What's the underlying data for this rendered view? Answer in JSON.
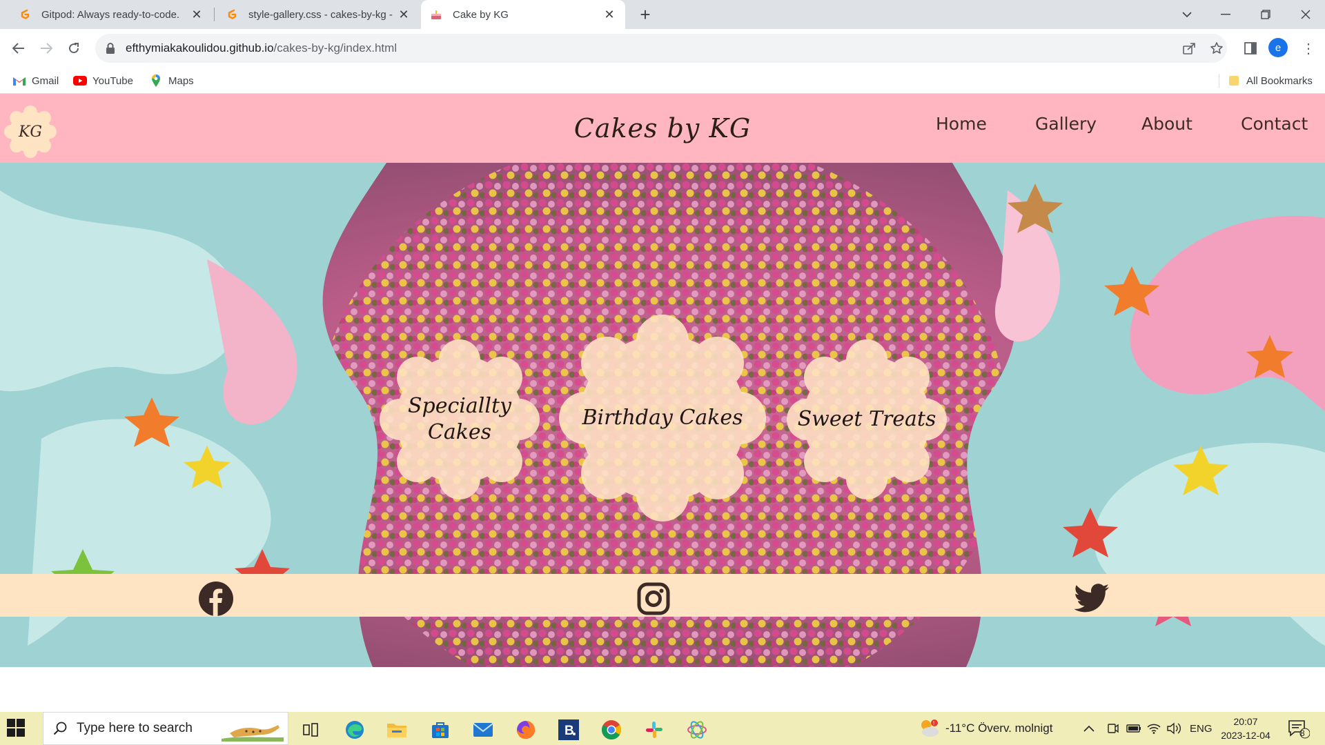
{
  "browser": {
    "tabs": [
      {
        "title": "Gitpod: Always ready-to-code.",
        "active": false,
        "icon": "gitpod-icon"
      },
      {
        "title": "style-gallery.css - cakes-by-kg -",
        "active": false,
        "icon": "gitpod-icon"
      },
      {
        "title": "Cake by KG",
        "active": true,
        "icon": "cake-icon"
      }
    ],
    "new_tab": "+",
    "url_domain": "efthymiakakoulidou.github.io",
    "url_path": "/cakes-by-kg/index.html",
    "profile_initial": "e",
    "bookmarks": [
      {
        "label": "Gmail",
        "icon": "gmail-icon"
      },
      {
        "label": "YouTube",
        "icon": "youtube-icon"
      },
      {
        "label": "Maps",
        "icon": "maps-icon"
      }
    ],
    "all_bookmarks": "All Bookmarks"
  },
  "site": {
    "logo_text": "KG",
    "title": "Cakes by KG",
    "nav": [
      "Home",
      "Gallery",
      "About",
      "Contact"
    ],
    "categories": [
      "Speciallty Cakes",
      "Birthday Cakes",
      "Sweet Treats"
    ],
    "social": [
      "facebook-icon",
      "instagram-icon",
      "twitter-icon"
    ],
    "colors": {
      "header": "#ffb6c1",
      "footer": "#ffe4c4",
      "blob": "#ffe4c4",
      "text": "#3b2a25"
    }
  },
  "taskbar": {
    "search_placeholder": "Type here to search",
    "weather": "-11°C  Överv. molnigt",
    "language": "ENG",
    "time": "20:07",
    "date": "2023-12-04",
    "notification_count": "8",
    "apps": [
      "task-view-icon",
      "edge-icon",
      "file-explorer-icon",
      "store-icon",
      "mail-icon",
      "firefox-icon",
      "b-app-icon",
      "chrome-icon",
      "slack-icon",
      "app-icon"
    ]
  }
}
